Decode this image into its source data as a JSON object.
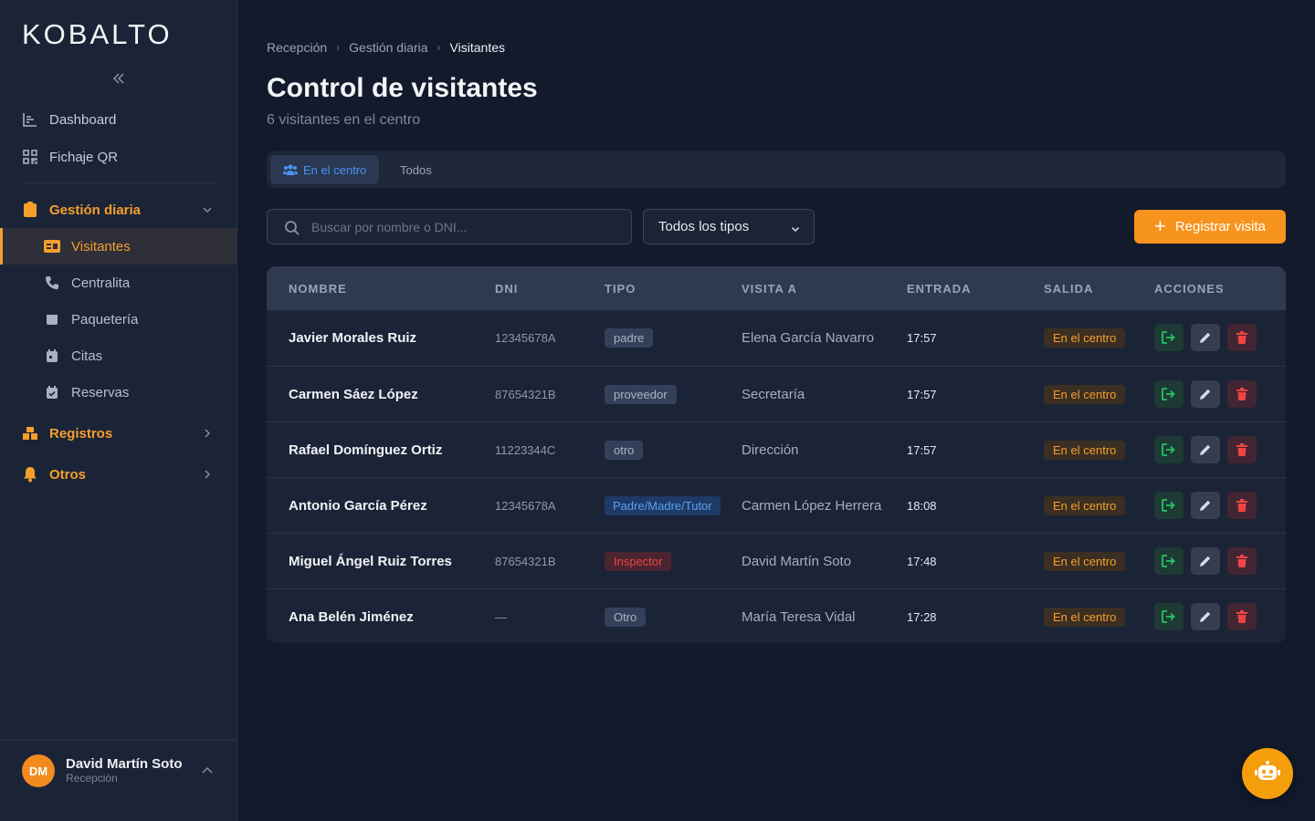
{
  "brand": {
    "logo": "KOBALTO"
  },
  "sidebar": {
    "top_items": [
      {
        "label": "Dashboard",
        "icon": "chart-icon"
      },
      {
        "label": "Fichaje QR",
        "icon": "qr-icon"
      }
    ],
    "groups": [
      {
        "label": "Gestión diaria",
        "expanded": true,
        "items": [
          {
            "label": "Visitantes",
            "active": true
          },
          {
            "label": "Centralita"
          },
          {
            "label": "Paquetería"
          },
          {
            "label": "Citas"
          },
          {
            "label": "Reservas"
          }
        ]
      },
      {
        "label": "Registros",
        "expanded": false
      },
      {
        "label": "Otros",
        "expanded": false
      }
    ]
  },
  "user": {
    "initials": "DM",
    "name": "David Martín Soto",
    "role": "Recepción"
  },
  "breadcrumb": [
    "Recepción",
    "Gestión diaria",
    "Visitantes"
  ],
  "page": {
    "title": "Control de visitantes",
    "subtitle": "6 visitantes en el centro"
  },
  "tabs": [
    {
      "label": "En el centro",
      "active": true
    },
    {
      "label": "Todos",
      "active": false
    }
  ],
  "filters": {
    "search_placeholder": "Buscar por nombre o DNI...",
    "type_select": "Todos los tipos"
  },
  "actions": {
    "register_label": "Registrar visita"
  },
  "table": {
    "columns": [
      "NOMBRE",
      "DNI",
      "TIPO",
      "VISITA A",
      "ENTRADA",
      "SALIDA",
      "ACCIONES"
    ],
    "rows": [
      {
        "nombre": "Javier Morales Ruiz",
        "dni": "12345678A",
        "tipo": "padre",
        "tipo_style": "gray",
        "visita": "Elena García Navarro",
        "entrada": "17:57",
        "salida": "En el centro"
      },
      {
        "nombre": "Carmen Sáez López",
        "dni": "87654321B",
        "tipo": "proveedor",
        "tipo_style": "gray",
        "visita": "Secretaría",
        "entrada": "17:57",
        "salida": "En el centro"
      },
      {
        "nombre": "Rafael Domínguez Ortiz",
        "dni": "11223344C",
        "tipo": "otro",
        "tipo_style": "gray",
        "visita": "Dirección",
        "entrada": "17:57",
        "salida": "En el centro"
      },
      {
        "nombre": "Antonio García Pérez",
        "dni": "12345678A",
        "tipo": "Padre/Madre/Tutor",
        "tipo_style": "blue",
        "visita": "Carmen López Herrera",
        "entrada": "18:08",
        "salida": "En el centro"
      },
      {
        "nombre": "Miguel Ángel Ruiz Torres",
        "dni": "87654321B",
        "tipo": "Inspector",
        "tipo_style": "red",
        "visita": "David Martín Soto",
        "entrada": "17:48",
        "salida": "En el centro"
      },
      {
        "nombre": "Ana Belén Jiménez",
        "dni": "—",
        "tipo": "Otro",
        "tipo_style": "gray",
        "visita": "María Teresa Vidal",
        "entrada": "17:28",
        "salida": "En el centro"
      }
    ]
  },
  "colors": {
    "accent": "#f7941d",
    "background": "#121a2c",
    "sidebar": "#1b2436",
    "exit": "#22c55e",
    "delete": "#ef4444",
    "tab_active": "#4b93f0"
  }
}
